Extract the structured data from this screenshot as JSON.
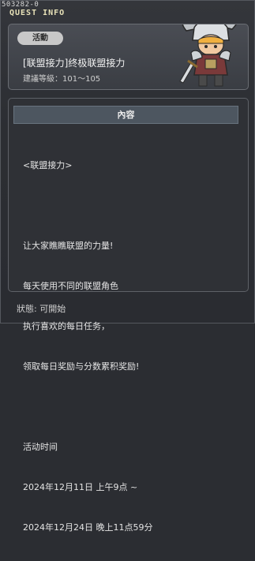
{
  "window": {
    "quest_id": "503282-0",
    "section_label": "QUEST INFO"
  },
  "header": {
    "tag_label": "活動",
    "title": "[联盟接力]终极联盟接力",
    "level_requirement": "建議等級：101～105",
    "character_image": "armored-warrior-character"
  },
  "content": {
    "header_label": "內容",
    "lines": [
      "<联盟接力>",
      "",
      "让大家瞧瞧联盟的力量!",
      "每天使用不同的联盟角色",
      "执行喜欢的每日任务，",
      "领取每日奖励与分数累积奖励!",
      "",
      "活动时间",
      "2024年12月11日 上午9点 ~",
      "2024年12月24日 晚上11点59分"
    ]
  },
  "footer": {
    "status": "狀態: 可開始"
  }
}
